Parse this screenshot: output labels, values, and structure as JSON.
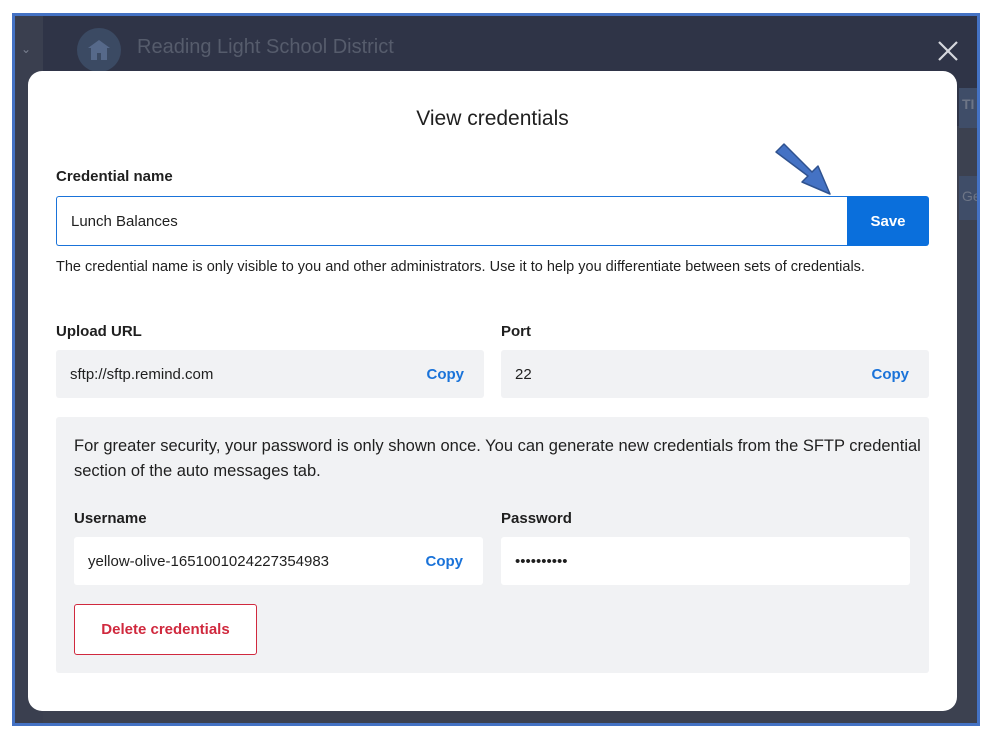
{
  "background": {
    "org_name": "Reading Light School District",
    "tab_fragment": "TI",
    "tab_fragment_2": "Ge"
  },
  "modal": {
    "title": "View credentials",
    "credential_name": {
      "label": "Credential name",
      "value": "Lunch Balances",
      "save_label": "Save",
      "helper": "The credential name is only visible to you and other administrators. Use it to help you differentiate between sets of credentials."
    },
    "upload_url": {
      "label": "Upload URL",
      "value": "sftp://sftp.remind.com",
      "copy_label": "Copy"
    },
    "port": {
      "label": "Port",
      "value": "22",
      "copy_label": "Copy"
    },
    "security": {
      "note": "For greater security, your password is only shown once. You can generate new credentials from the SFTP credential section of the auto messages tab.",
      "username": {
        "label": "Username",
        "value": "yellow-olive-1651001024227354983",
        "copy_label": "Copy"
      },
      "password": {
        "label": "Password",
        "value": "••••••••••"
      },
      "delete_label": "Delete credentials"
    }
  },
  "colors": {
    "accent": "#0a6fdc",
    "danger": "#d0293e",
    "annotation_arrow": "#4472c4"
  }
}
